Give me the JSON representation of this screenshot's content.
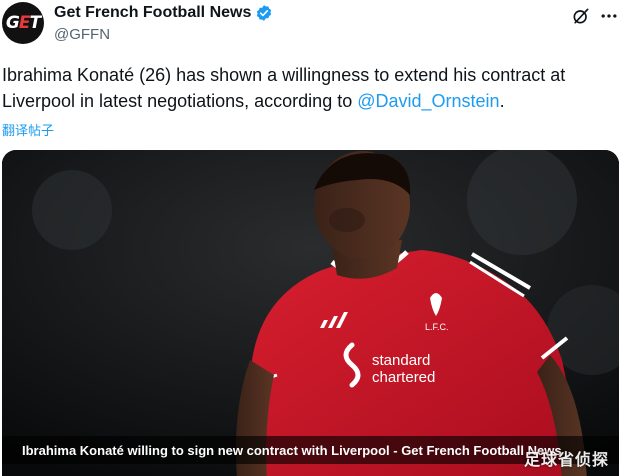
{
  "account": {
    "display_name": "Get French Football News",
    "handle": "@GFFN",
    "avatar_text": "GET",
    "verified": true
  },
  "tweet": {
    "text_before": "Ibrahima Konaté (26) has shown a willingness to extend his contract at Liverpool in latest negotiations, according to ",
    "mention": "@David_Ornstein",
    "text_after": ".",
    "translate_label": "翻译帖子"
  },
  "media": {
    "caption": "Ibrahima Konaté willing to sign new contract with Liverpool - Get French Football News",
    "shirt_sponsor_line1": "standard",
    "shirt_sponsor_line2": "chartered",
    "badge_text": "L.F.C.",
    "watermark": "足球省侦探"
  },
  "icons": {
    "grok": "grok-icon",
    "more": "more-icon",
    "verified": "verified-badge-icon"
  },
  "colors": {
    "link": "#1d9bf0",
    "verified": "#1d9bf0",
    "shirt": "#c8102e"
  }
}
